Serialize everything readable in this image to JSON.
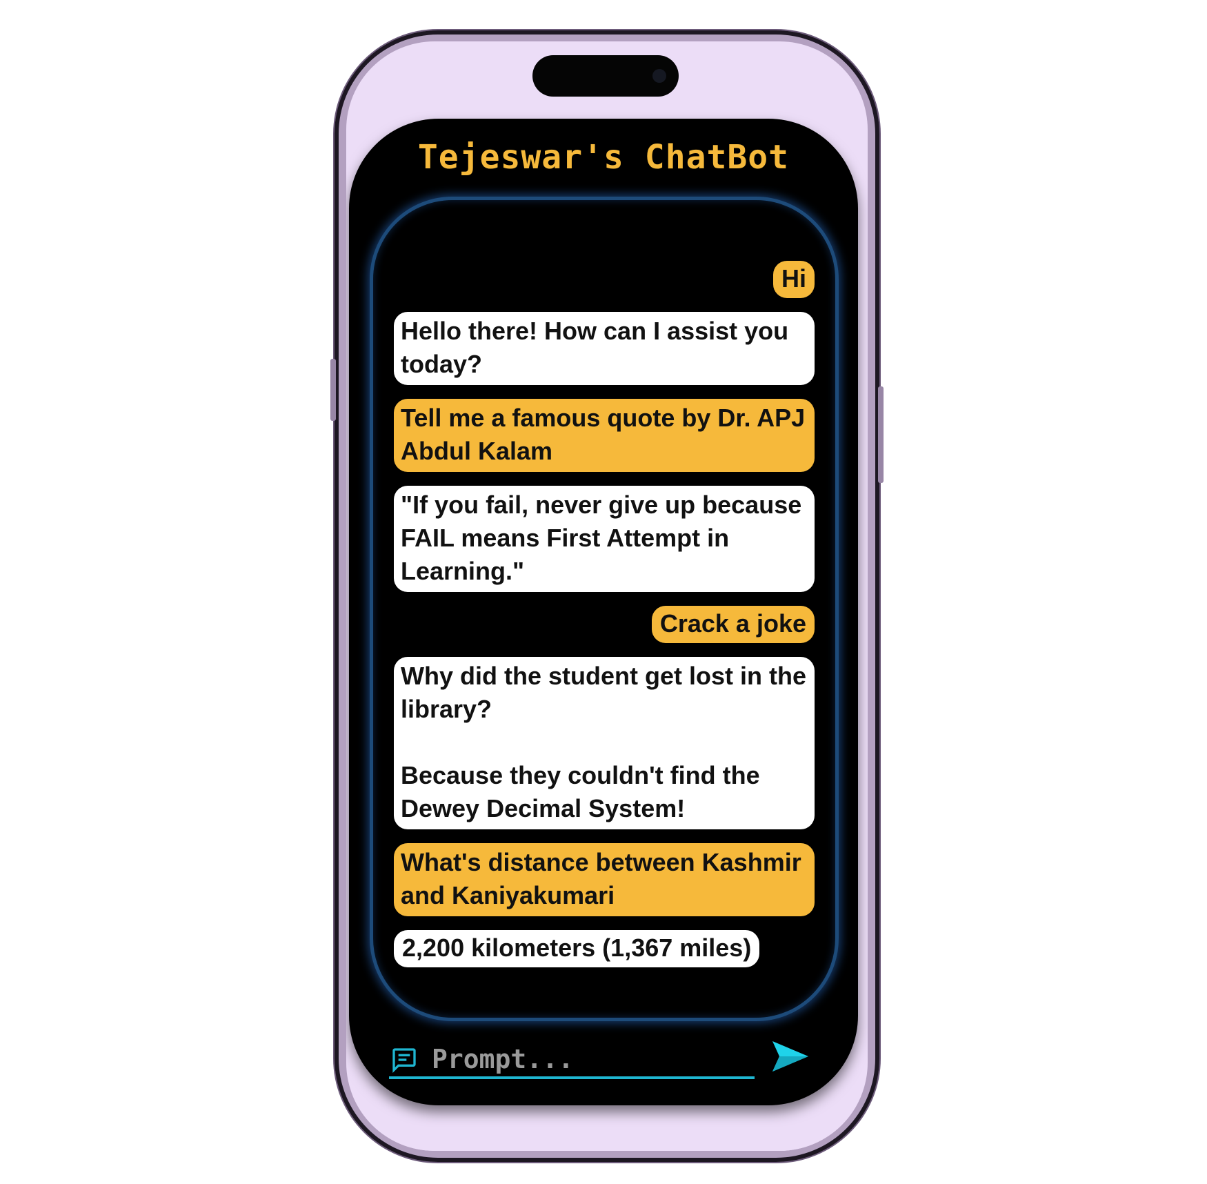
{
  "app": {
    "title": "Tejeswar's ChatBot",
    "accent_color": "#f6b93b",
    "panel_border_color": "#1d4b7a",
    "input_underline_color": "#1fb6d1"
  },
  "messages": [
    {
      "role": "user",
      "text": "Hi"
    },
    {
      "role": "bot",
      "text": "Hello there! How can I assist you today?"
    },
    {
      "role": "user",
      "text": "Tell me a famous quote by Dr. APJ Abdul Kalam"
    },
    {
      "role": "bot",
      "text": "\"If you fail, never give up because FAIL means First Attempt in Learning.\""
    },
    {
      "role": "user",
      "text": "Crack a joke"
    },
    {
      "role": "bot",
      "text": "Why did the student get lost in the library?\n\nBecause they couldn't find the Dewey Decimal System!"
    },
    {
      "role": "user",
      "text": "What's distance between Kashmir and Kaniyakumari"
    },
    {
      "role": "bot",
      "text": "2,200 kilometers (1,367 miles)"
    }
  ],
  "input": {
    "placeholder": "Prompt...",
    "value": "",
    "icon": "chat-bubble-icon",
    "send_icon": "send-icon"
  }
}
